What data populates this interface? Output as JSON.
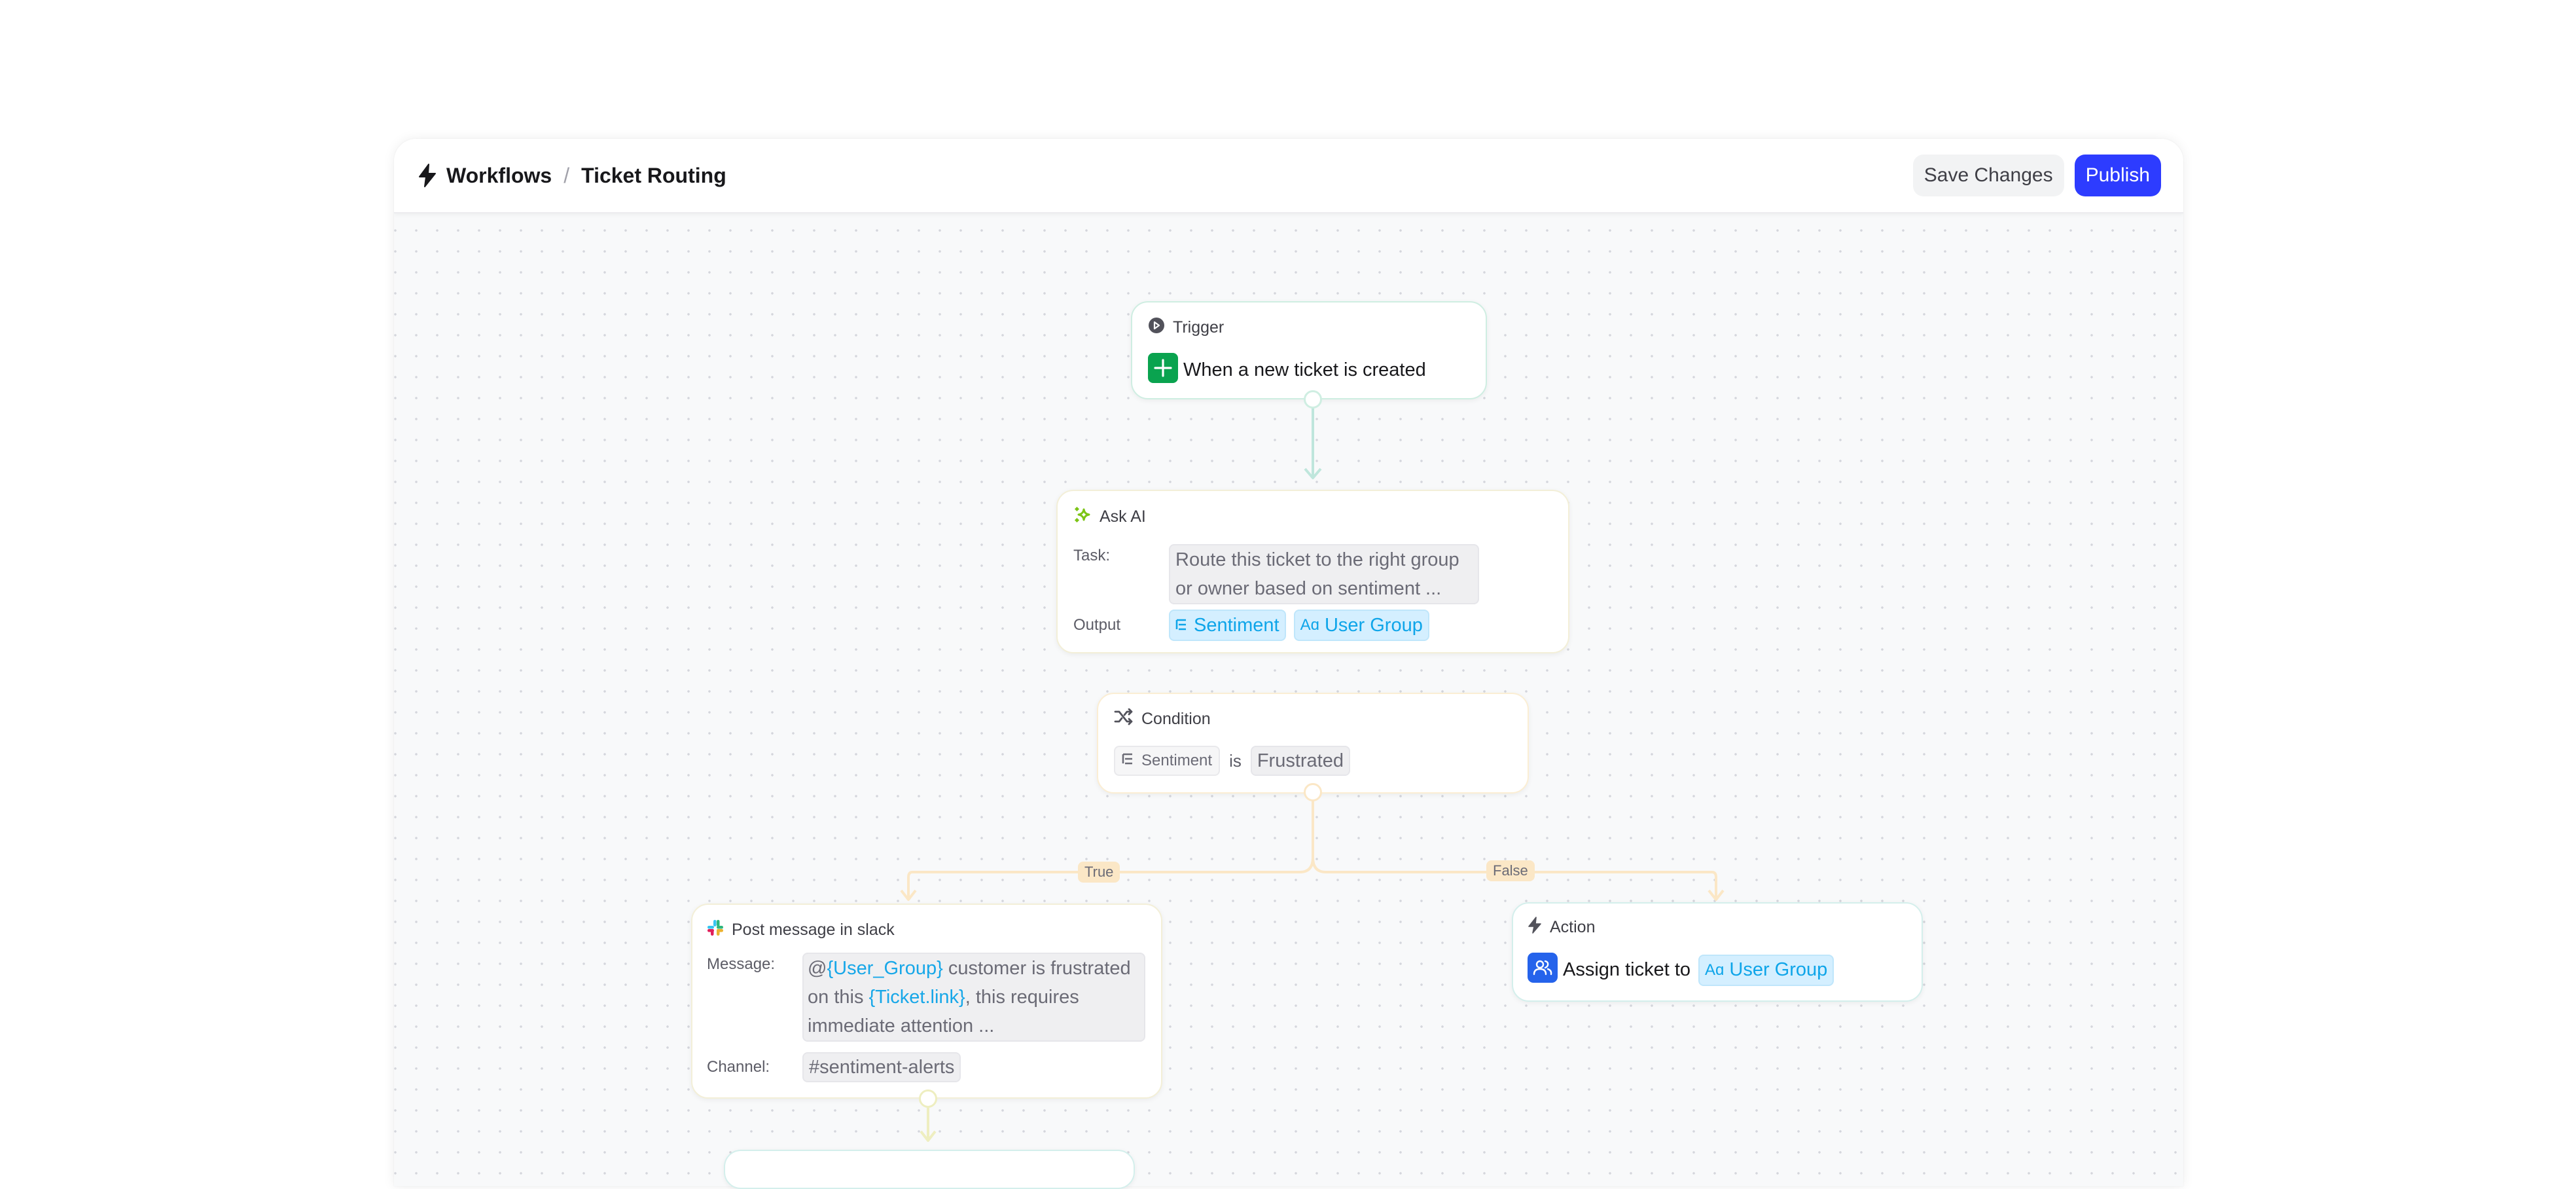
{
  "header": {
    "app_icon": "bolt-icon",
    "breadcrumb": [
      "Workflows",
      "Ticket Routing"
    ],
    "separator": "/",
    "save_label": "Save Changes",
    "publish_label": "Publish"
  },
  "colors": {
    "primary": "#2d3cff",
    "trigger_edge": "#bfe6dc",
    "condition_edge": "#fbe7c6",
    "slack_edge": "#eeeec0",
    "chip_blue": "#0ea5e9"
  },
  "nodes": {
    "trigger": {
      "title": "Trigger",
      "icon": "play-circle-icon",
      "event_icon": "plus-icon",
      "event": "When a new ticket is created"
    },
    "ask_ai": {
      "title": "Ask AI",
      "icon": "sparkle-icon",
      "task_label": "Task:",
      "task_line1": "Route this ticket to the right group",
      "task_line2": "or owner based on sentiment ...",
      "output_label": "Output",
      "outputs": [
        {
          "icon": "list-icon",
          "label": "Sentiment"
        },
        {
          "icon": "text-type-icon",
          "icon_text": "Aɑ",
          "label": "User Group"
        }
      ]
    },
    "condition": {
      "title": "Condition",
      "icon": "shuffle-icon",
      "field": "Sentiment",
      "operator": "is",
      "value": "Frustrated",
      "branches": {
        "true_label": "True",
        "false_label": "False"
      }
    },
    "slack": {
      "title": "Post message in slack",
      "icon": "slack-icon",
      "message_label": "Message:",
      "message": {
        "at": "@",
        "var1": "{User_Group}",
        "text1": " customer is frustrated",
        "text2": "on this ",
        "var2": "{Ticket.link}",
        "text3": ", this requires",
        "text4": "immediate attention ..."
      },
      "channel_label": "Channel:",
      "channel": "#sentiment-alerts"
    },
    "action": {
      "title": "Action",
      "icon": "bolt-icon",
      "action_icon": "users-icon",
      "text": "Assign ticket to",
      "chip_icon_text": "Aɑ",
      "chip_label": "User Group"
    }
  }
}
